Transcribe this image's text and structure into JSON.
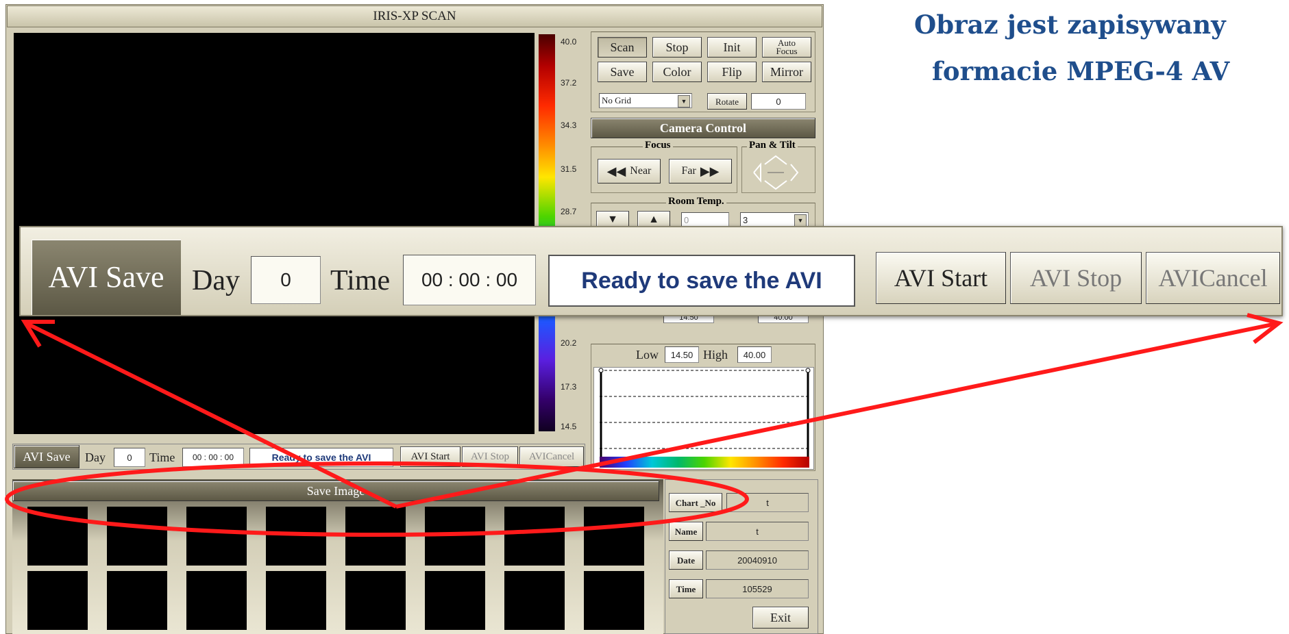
{
  "app": {
    "title": "IRIS-XP SCAN"
  },
  "slide": {
    "heading_line1": "Obraz jest zapisywany",
    "heading_line2": "formacie MPEG-4  AV"
  },
  "colorbar": {
    "ticks": [
      "40.0",
      "37.2",
      "34.3",
      "31.5",
      "28.7",
      "20.2",
      "17.3",
      "14.5"
    ]
  },
  "toolbar": {
    "buttons": [
      "Scan",
      "Stop",
      "Init",
      "Auto Focus",
      "Save",
      "Color",
      "Flip",
      "Mirror"
    ],
    "grid_select": "No Grid",
    "rotate_label": "Rotate",
    "rotate_value": "0"
  },
  "camera": {
    "title": "Camera Control",
    "focus_label": "Focus",
    "near_label": "Near",
    "far_label": "Far",
    "pantilt_label": "Pan & Tilt",
    "room_temp_label": "Room Temp.",
    "room_temp_value": "0",
    "room_select": "3"
  },
  "partial_values": {
    "low_hidden": "14.50",
    "high_hidden": "40.00"
  },
  "histogram": {
    "low_label": "Low",
    "low_value": "14.50",
    "high_label": "High",
    "high_value": "40.00"
  },
  "avi": {
    "save_label": "AVI Save",
    "day_label": "Day",
    "day_value": "0",
    "time_label": "Time",
    "time_value": "00 : 00 : 00",
    "status": "Ready to save the AVI",
    "start_label": "AVI Start",
    "stop_label": "AVI Stop",
    "cancel_label": "AVICancel"
  },
  "save_image": {
    "title": "Save Image"
  },
  "info": {
    "chart_no_label": "Chart _No",
    "chart_no_value": "t",
    "name_label": "Name",
    "name_value": "t",
    "date_label": "Date",
    "date_value": "20040910",
    "time_label": "Time",
    "time_value": "105529",
    "exit_label": "Exit"
  },
  "colors": {
    "annotation": "#ff1a1a",
    "heading": "#1f4e8c",
    "panel": "#d4cfb8"
  }
}
